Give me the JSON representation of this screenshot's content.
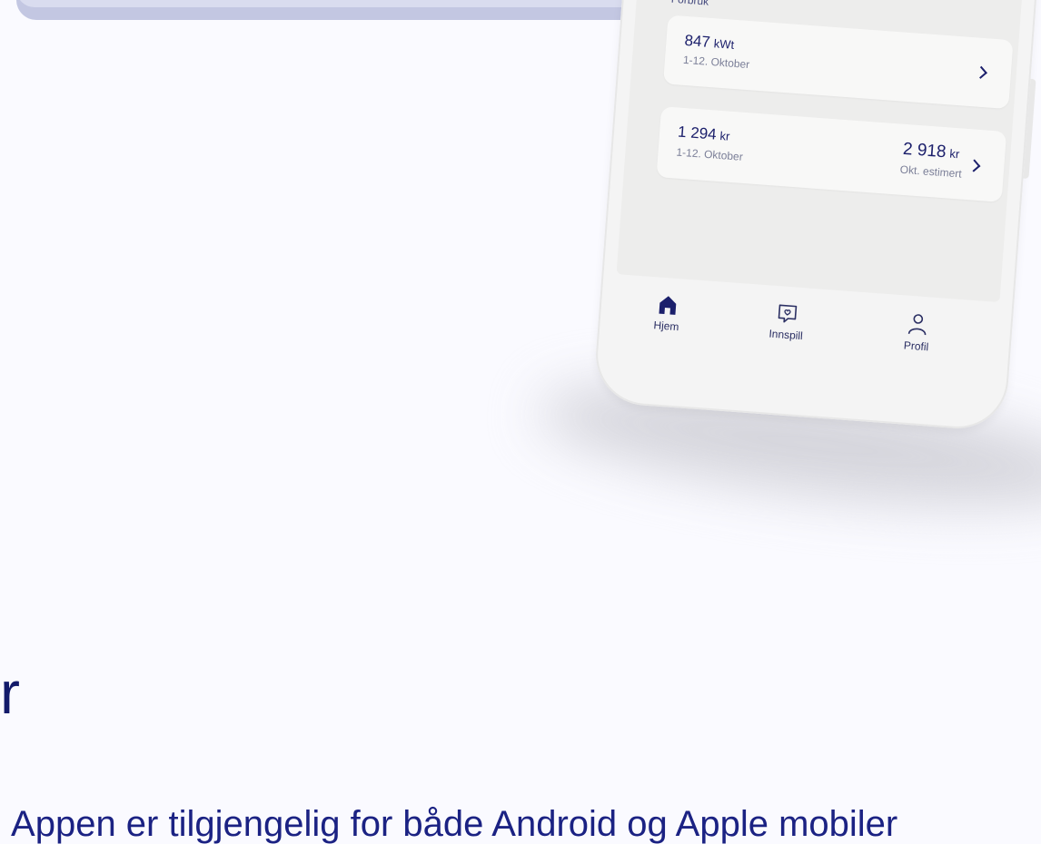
{
  "background": {
    "color": "#fafaff"
  },
  "phone": {
    "section_label": "Forbruk",
    "consumption_card": {
      "value": "847",
      "unit": "kWt",
      "period": "1-12. Oktober"
    },
    "cost_card": {
      "value": "1 294",
      "unit": "kr",
      "period": "1-12. Oktober",
      "estimate_value": "2 918",
      "estimate_unit": "kr",
      "estimate_label": "Okt. estimert"
    },
    "tabs": [
      {
        "label": "Hjem",
        "icon": "home-icon",
        "active": true
      },
      {
        "label": "Innspill",
        "icon": "feedback-heart-icon",
        "active": false
      },
      {
        "label": "Profil",
        "icon": "user-icon",
        "active": false
      }
    ]
  },
  "heading_fragment": "r",
  "body_text": ". Appen er tilgjengelig for både Android og Apple mobiler",
  "colors": {
    "accent": "#1b1f6b",
    "heading": "#121a6a"
  }
}
